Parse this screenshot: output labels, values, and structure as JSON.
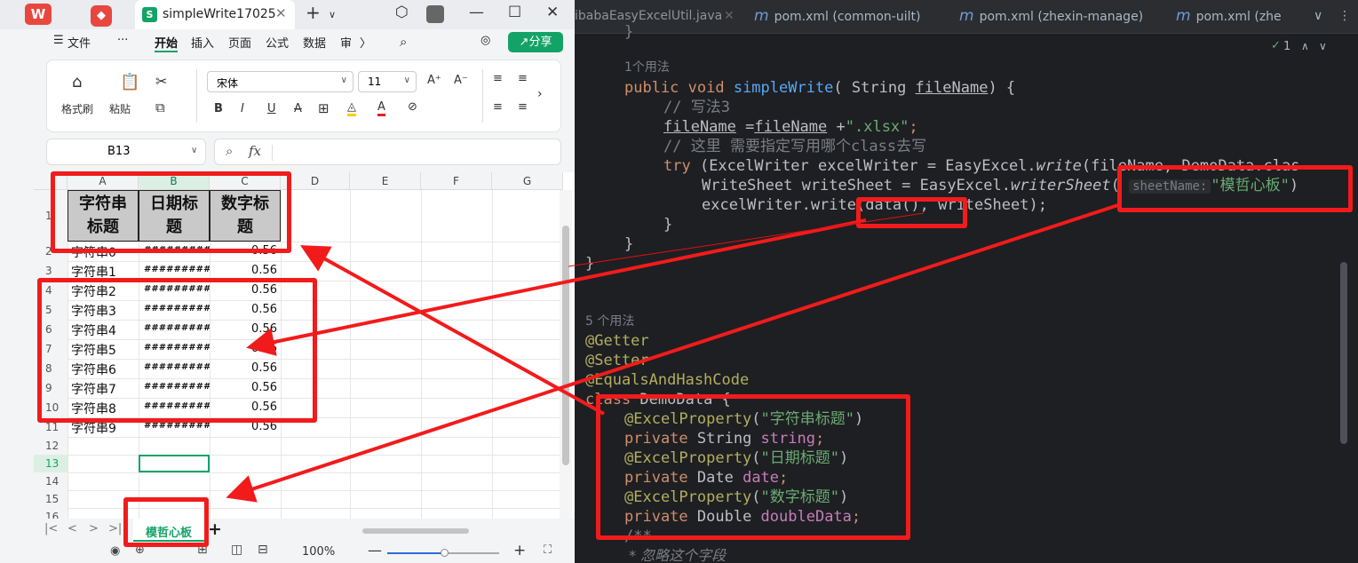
{
  "wps": {
    "doc_tab_title": "simpleWrite17025",
    "menus": [
      "文件",
      "开始",
      "插入",
      "页面",
      "公式",
      "数据",
      "审"
    ],
    "share_label": "分享",
    "ribbon": {
      "format_painter": "格式刷",
      "paste": "粘贴",
      "font_name": "宋体",
      "font_size": "11",
      "bold": "B",
      "italic": "I",
      "underline": "U",
      "strikethrough": "A"
    },
    "namebox": "B13",
    "fx": "fx",
    "columns": [
      "A",
      "B",
      "C",
      "D",
      "E",
      "F",
      "G"
    ],
    "header_row": [
      "字符串标题",
      "日期标题",
      "数字标题"
    ],
    "header_row_wrapped": [
      [
        "字符串",
        "标题"
      ],
      [
        "日期标",
        "题"
      ],
      [
        "数字标",
        "题"
      ]
    ],
    "rows": [
      {
        "num": "2",
        "a": "字符串0",
        "b": "#########",
        "c": "0.56"
      },
      {
        "num": "3",
        "a": "字符串1",
        "b": "#########",
        "c": "0.56"
      },
      {
        "num": "4",
        "a": "字符串2",
        "b": "#########",
        "c": "0.56"
      },
      {
        "num": "5",
        "a": "字符串3",
        "b": "#########",
        "c": "0.56"
      },
      {
        "num": "6",
        "a": "字符串4",
        "b": "#########",
        "c": "0.56"
      },
      {
        "num": "7",
        "a": "字符串5",
        "b": "#########",
        "c": "0.56"
      },
      {
        "num": "8",
        "a": "字符串6",
        "b": "#########",
        "c": "0.56"
      },
      {
        "num": "9",
        "a": "字符串7",
        "b": "#########",
        "c": "0.56"
      },
      {
        "num": "10",
        "a": "字符串8",
        "b": "#########",
        "c": "0.56"
      },
      {
        "num": "11",
        "a": "字符串9",
        "b": "#########",
        "c": "0.56"
      }
    ],
    "empty_rows": [
      "12",
      "13",
      "14",
      "15",
      "16"
    ],
    "sheet_tab": "模哲心板",
    "zoom": "100%"
  },
  "ide": {
    "tabs": [
      "ibabaEasyExcelUtil.java",
      "pom.xml (common-uilt)",
      "pom.xml (zhexin-manage)",
      "pom.xml (zhe"
    ],
    "inspection_count": "1",
    "usages_1": "1个用法",
    "usages_5": "5 个用法",
    "code": {
      "method_sig_kw": "public void ",
      "method_name": "simpleWrite",
      "method_params": "( String ",
      "param": "fileName",
      "method_tail": ") {",
      "c1": "// 写法3",
      "assign_tail": " +",
      "assign_str": "\".xlsx\"",
      "c2": "// 这里 需要指定写用哪个class去写",
      "try_kw": "try",
      "try_body": " (ExcelWriter excelWriter = EasyExcel.",
      "write_fn": "write",
      "try_tail": "(fileName, DemoData.clas",
      "ws_line": "WriteSheet writeSheet = EasyExcel.",
      "ws_fn": "writerSheet",
      "ws_hint": "sheetName:",
      "ws_str": "\"模哲心板\"",
      "ws_tail": ")",
      "write_line": "excelWriter.write(data(), writeSheet);",
      "close_brace": "}",
      "a_getter": "@Getter",
      "a_setter": "@Setter",
      "a_equals": "@EqualsAndHashCode",
      "class_kw": "class ",
      "class_name": "DemoData {",
      "ep": "@ExcelProperty",
      "ep1": "\"字符串标题\"",
      "ep2": "\"日期标题\"",
      "ep3": "\"数字标题\"",
      "private_kw": "private ",
      "f1_type": "String ",
      "f1": "string",
      "f2_type": "Date ",
      "f2": "date",
      "f3_type": "Double ",
      "f3": "doubleData",
      "doc_start": "/**",
      "doc_line": " * 忽略这个字段"
    }
  },
  "colors": {
    "highlight": "#f21b1b",
    "accent": "#14a367"
  }
}
